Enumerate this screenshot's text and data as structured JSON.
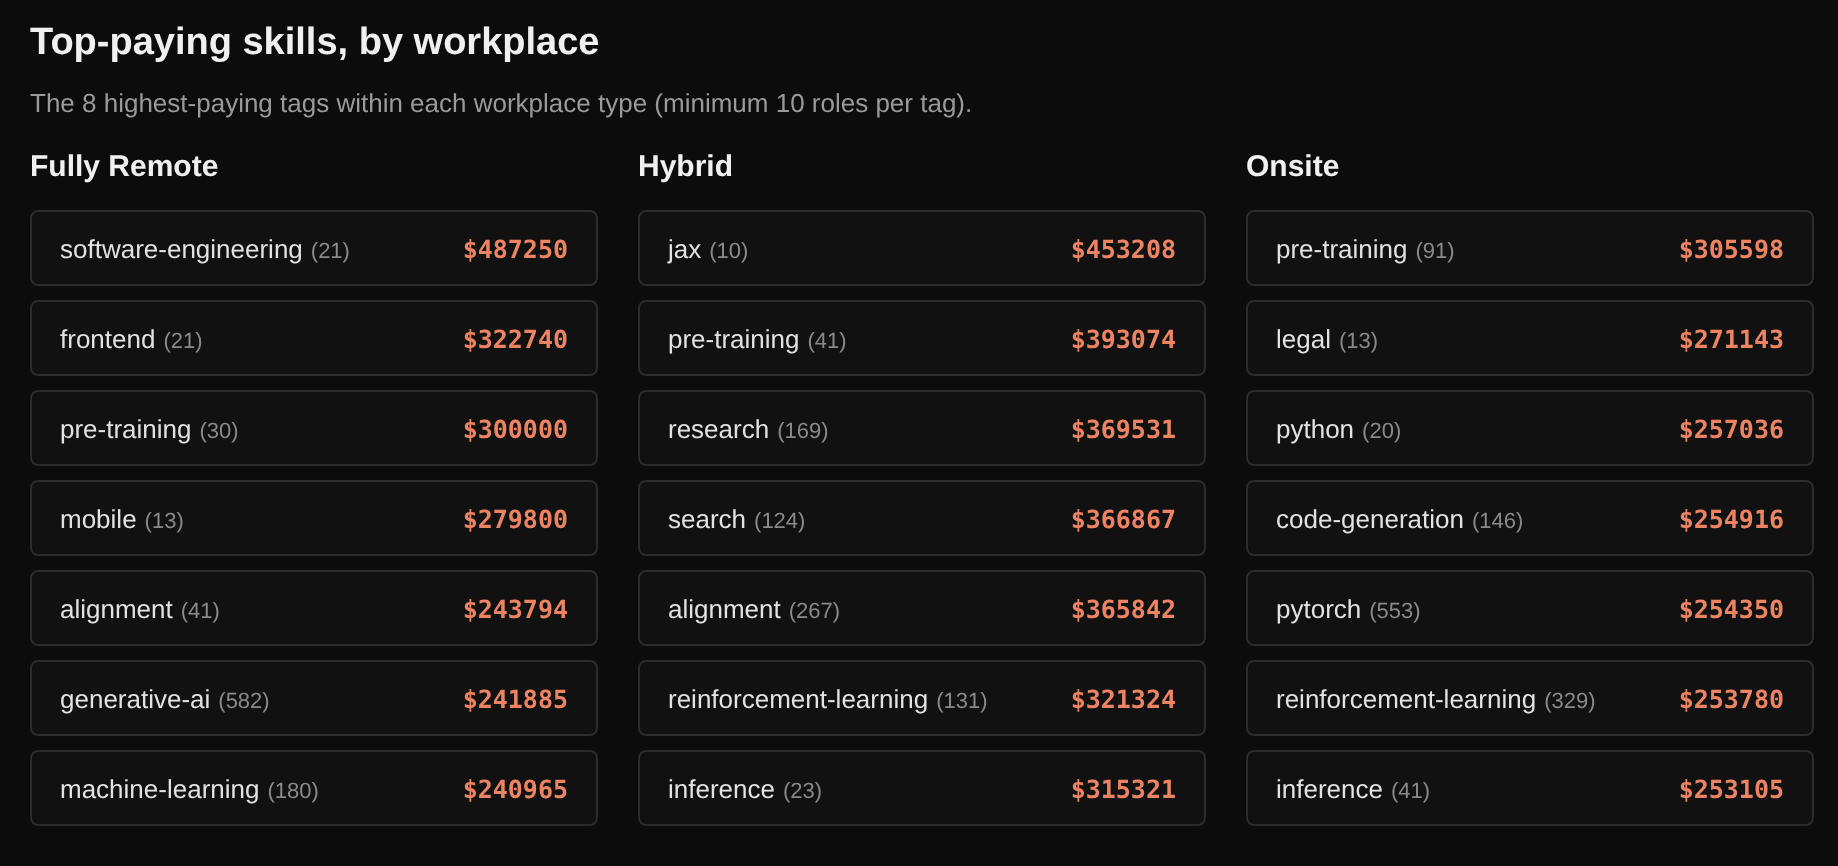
{
  "title": "Top-paying skills, by workplace",
  "subtitle": "The 8 highest-paying tags within each workplace type (minimum 10 roles per tag).",
  "columns": [
    {
      "heading": "Fully Remote",
      "items": [
        {
          "tag": "software-engineering",
          "count": "(21)",
          "salary": "$487250"
        },
        {
          "tag": "frontend",
          "count": "(21)",
          "salary": "$322740"
        },
        {
          "tag": "pre-training",
          "count": "(30)",
          "salary": "$300000"
        },
        {
          "tag": "mobile",
          "count": "(13)",
          "salary": "$279800"
        },
        {
          "tag": "alignment",
          "count": "(41)",
          "salary": "$243794"
        },
        {
          "tag": "generative-ai",
          "count": "(582)",
          "salary": "$241885"
        },
        {
          "tag": "machine-learning",
          "count": "(180)",
          "salary": "$240965"
        }
      ]
    },
    {
      "heading": "Hybrid",
      "items": [
        {
          "tag": "jax",
          "count": "(10)",
          "salary": "$453208"
        },
        {
          "tag": "pre-training",
          "count": "(41)",
          "salary": "$393074"
        },
        {
          "tag": "research",
          "count": "(169)",
          "salary": "$369531"
        },
        {
          "tag": "search",
          "count": "(124)",
          "salary": "$366867"
        },
        {
          "tag": "alignment",
          "count": "(267)",
          "salary": "$365842"
        },
        {
          "tag": "reinforcement-learning",
          "count": "(131)",
          "salary": "$321324"
        },
        {
          "tag": "inference",
          "count": "(23)",
          "salary": "$315321"
        }
      ]
    },
    {
      "heading": "Onsite",
      "items": [
        {
          "tag": "pre-training",
          "count": "(91)",
          "salary": "$305598"
        },
        {
          "tag": "legal",
          "count": "(13)",
          "salary": "$271143"
        },
        {
          "tag": "python",
          "count": "(20)",
          "salary": "$257036"
        },
        {
          "tag": "code-generation",
          "count": "(146)",
          "salary": "$254916"
        },
        {
          "tag": "pytorch",
          "count": "(553)",
          "salary": "$254350"
        },
        {
          "tag": "reinforcement-learning",
          "count": "(329)",
          "salary": "$253780"
        },
        {
          "tag": "inference",
          "count": "(41)",
          "salary": "$253105"
        }
      ]
    }
  ]
}
